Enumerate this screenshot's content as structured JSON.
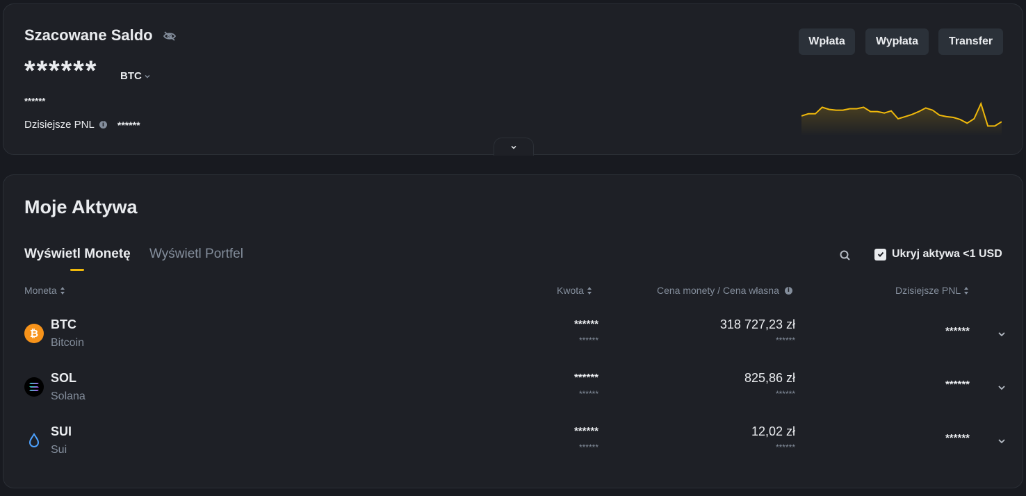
{
  "balance": {
    "title": "Szacowane Saldo",
    "hidden_amount": "******",
    "currency": "BTC",
    "hidden_fiat": "******",
    "pnl_label": "Dzisiejsze PNL",
    "pnl_value": "******",
    "buttons": {
      "deposit": "Wpłata",
      "withdraw": "Wypłata",
      "transfer": "Transfer"
    },
    "sparkline": [
      28,
      31,
      31,
      40,
      37,
      36,
      36,
      38,
      38,
      40,
      34,
      34,
      32,
      35,
      24,
      27,
      30,
      34,
      39,
      36,
      29,
      27,
      26,
      23,
      18,
      24,
      45,
      14,
      14,
      20
    ],
    "accent_color": "#f0b90b"
  },
  "assets": {
    "title": "Moje Aktywa",
    "tabs": {
      "coin": "Wyświetl Monetę",
      "wallet": "Wyświetl Portfel"
    },
    "hide_small_label": "Ukryj aktywa <1 USD",
    "hide_small_checked": true,
    "columns": {
      "coin": "Moneta",
      "amount": "Kwota",
      "price": "Cena monety / Cena własna",
      "pnl": "Dzisiejsze PNL"
    },
    "rows": [
      {
        "symbol": "BTC",
        "name": "Bitcoin",
        "amount": "******",
        "amount_sub": "******",
        "price": "318 727,23 zł",
        "price_sub": "******",
        "pnl": "******",
        "icon": "bitcoin-icon"
      },
      {
        "symbol": "SOL",
        "name": "Solana",
        "amount": "******",
        "amount_sub": "******",
        "price": "825,86 zł",
        "price_sub": "******",
        "pnl": "******",
        "icon": "solana-icon"
      },
      {
        "symbol": "SUI",
        "name": "Sui",
        "amount": "******",
        "amount_sub": "******",
        "price": "12,02 zł",
        "price_sub": "******",
        "pnl": "******",
        "icon": "sui-icon"
      }
    ]
  }
}
